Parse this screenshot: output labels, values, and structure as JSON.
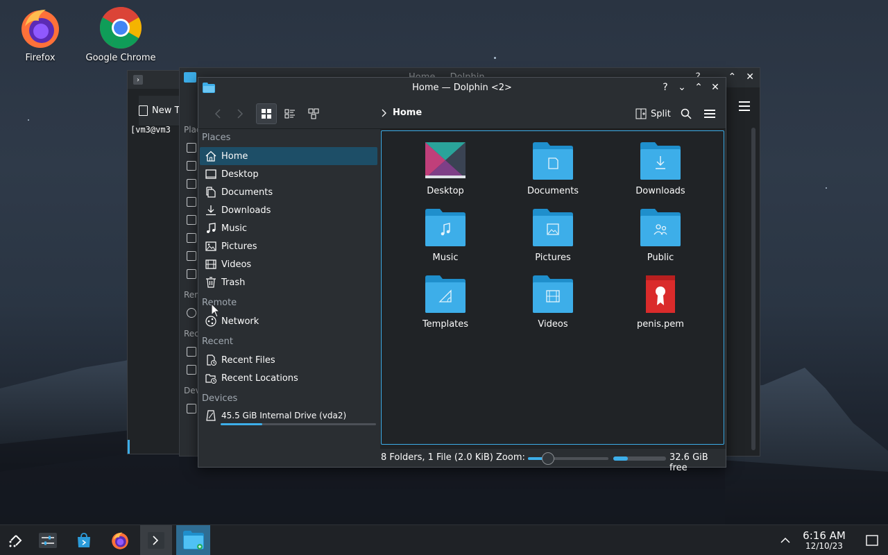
{
  "desktop": {
    "icons": [
      {
        "label": "Firefox"
      },
      {
        "label": "Google Chrome"
      }
    ]
  },
  "bg_konsole": {
    "toolbar_label": "New T",
    "prompt": "[vm3@vm3"
  },
  "bg_dolphin": {
    "title": "Home — Dolphin",
    "side_labels": [
      "Plac",
      "Rem",
      "Rec",
      "Dev"
    ]
  },
  "window": {
    "title": "Home — Dolphin <2>",
    "controls": [
      "?",
      "⌄",
      "⌃",
      "✕"
    ]
  },
  "toolbar": {
    "breadcrumb": "Home",
    "split_label": "Split"
  },
  "places": {
    "sections": {
      "places": "Places",
      "remote": "Remote",
      "recent": "Recent",
      "devices": "Devices"
    },
    "items": [
      {
        "label": "Home",
        "icon": "home-icon"
      },
      {
        "label": "Desktop",
        "icon": "desktop-icon"
      },
      {
        "label": "Documents",
        "icon": "documents-icon"
      },
      {
        "label": "Downloads",
        "icon": "downloads-icon"
      },
      {
        "label": "Music",
        "icon": "music-icon"
      },
      {
        "label": "Pictures",
        "icon": "pictures-icon"
      },
      {
        "label": "Videos",
        "icon": "videos-icon"
      },
      {
        "label": "Trash",
        "icon": "trash-icon"
      }
    ],
    "remote_items": [
      {
        "label": "Network",
        "icon": "network-icon"
      }
    ],
    "recent_items": [
      {
        "label": "Recent Files",
        "icon": "recent-files-icon"
      },
      {
        "label": "Recent Locations",
        "icon": "recent-locations-icon"
      }
    ],
    "devices": [
      {
        "label": "45.5 GiB Internal Drive (vda2)",
        "icon": "drive-icon",
        "usage_fraction": 0.27
      }
    ]
  },
  "files": [
    {
      "name": "Desktop",
      "type": "desktop-folder"
    },
    {
      "name": "Documents",
      "type": "folder-documents"
    },
    {
      "name": "Downloads",
      "type": "folder-downloads"
    },
    {
      "name": "Music",
      "type": "folder-music"
    },
    {
      "name": "Pictures",
      "type": "folder-pictures"
    },
    {
      "name": "Public",
      "type": "folder-public"
    },
    {
      "name": "Templates",
      "type": "folder-templates"
    },
    {
      "name": "Videos",
      "type": "folder-videos"
    },
    {
      "name": "penis.pem",
      "type": "certificate-file"
    }
  ],
  "status": {
    "info": "8 Folders, 1 File (2.0 KiB)",
    "zoom_label": "Zoom:",
    "zoom_fraction": 0.25,
    "free_fraction": 0.28,
    "free_text": "32.6 GiB free"
  },
  "taskbar": {
    "time": "6:16 AM",
    "date": "12/10/23",
    "items": [
      "app-launcher-icon",
      "settings-icon",
      "discover-icon",
      "firefox-icon",
      "konsole-icon",
      "dolphin-icon"
    ]
  },
  "colors": {
    "accent": "#3daee9",
    "folder": "#3daee9",
    "selection": "#1d4e67",
    "window_bg": "#202326",
    "panel_bg": "#2a2e32"
  }
}
